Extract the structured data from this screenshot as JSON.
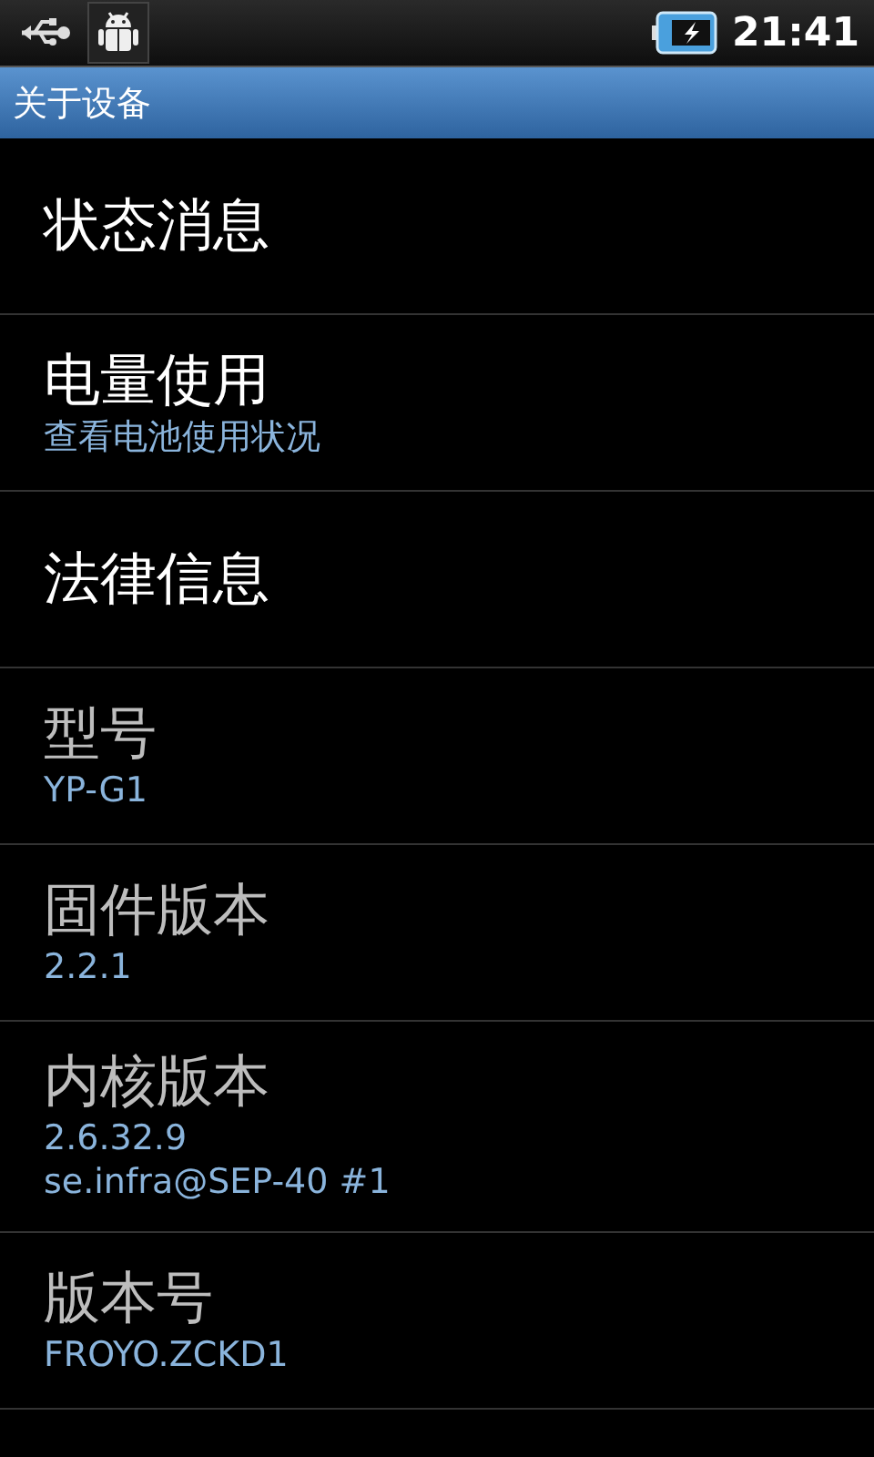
{
  "status_bar": {
    "time": "21:41",
    "battery_charging": true
  },
  "title_bar": {
    "title": "关于设备"
  },
  "items": [
    {
      "title": "状态消息",
      "disabled": false
    },
    {
      "title": "电量使用",
      "disabled": false,
      "summary_lines": [
        "查看电池使用状况"
      ]
    },
    {
      "title": "法律信息",
      "disabled": false
    },
    {
      "title": "型号",
      "disabled": true,
      "summary_lines": [
        "YP-G1"
      ]
    },
    {
      "title": "固件版本",
      "disabled": true,
      "summary_lines": [
        "2.2.1"
      ]
    },
    {
      "title": "内核版本",
      "disabled": true,
      "summary_lines": [
        "2.6.32.9",
        "se.infra@SEP-40 #1"
      ]
    },
    {
      "title": "版本号",
      "disabled": true,
      "summary_lines": [
        "FROYO.ZCKD1"
      ]
    }
  ]
}
